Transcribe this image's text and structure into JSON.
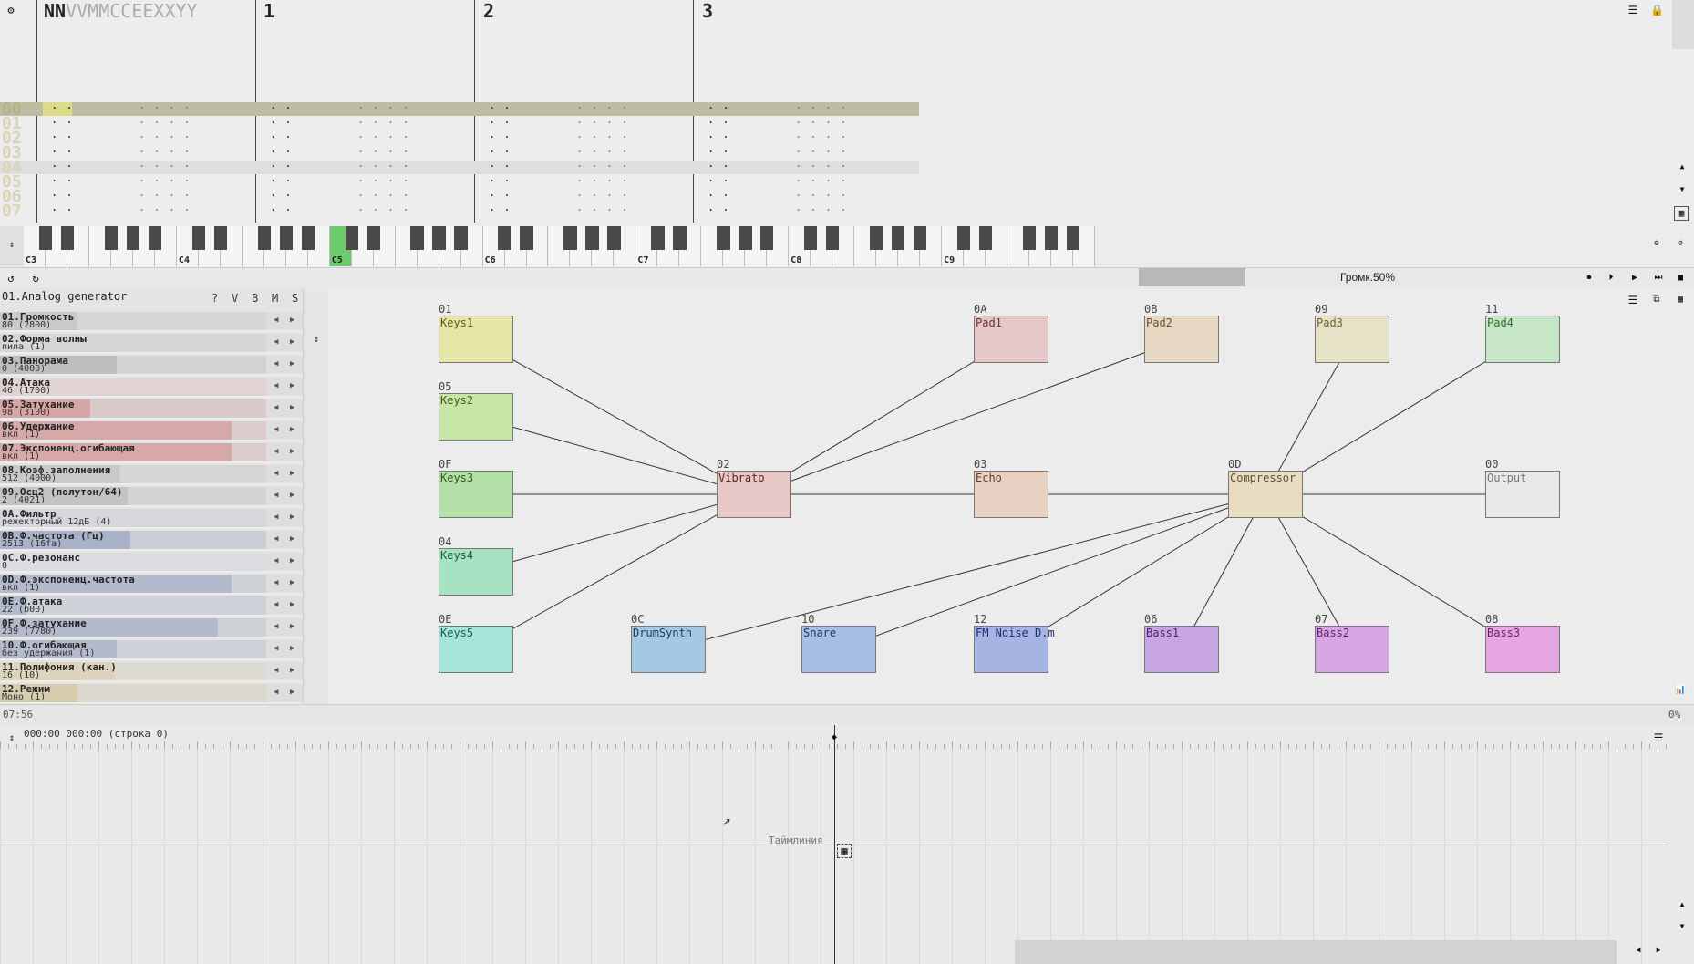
{
  "pattern": {
    "header_name": "NNVVMMCCEEXXYY",
    "header_name_bold": "NN",
    "header_name_rest": "VVMMCCEEXXYY",
    "channels": [
      "1",
      "2",
      "3"
    ],
    "rows": [
      "00",
      "01",
      "02",
      "03",
      "04",
      "05",
      "06",
      "07"
    ]
  },
  "piano": {
    "octaves": [
      "C3",
      "C4",
      "C5",
      "C6",
      "C7",
      "C8",
      "C9"
    ],
    "active_octave": "C5"
  },
  "toolbar": {
    "volume_label": "Громк.50%"
  },
  "instrument": {
    "title": "01.Analog generator",
    "flags": [
      "?",
      "V",
      "B",
      "M",
      "S"
    ]
  },
  "params": [
    {
      "name": "01.Громкость",
      "value": "80 (2800)",
      "fill": 0.29,
      "color": "#c9c9c9"
    },
    {
      "name": "02.Форма волны",
      "value": "пила (1)",
      "fill": 0.0,
      "color": "#c9c9c9"
    },
    {
      "name": "03.Панорама",
      "value": "0 (4000)",
      "fill": 0.44,
      "color": "#bdbdbd"
    },
    {
      "name": "04.Атака",
      "value": "46 (1700)",
      "fill": 0.0,
      "color": "#e7c0c0"
    },
    {
      "name": "05.Затухание",
      "value": "98 (3100)",
      "fill": 0.34,
      "color": "#d8a6a6"
    },
    {
      "name": "06.Удержание",
      "value": "вкл (1)",
      "fill": 0.87,
      "color": "#d6a8a8"
    },
    {
      "name": "07.Экспоненц.огибающая",
      "value": "вкл (1)",
      "fill": 0.87,
      "color": "#d6a8a8"
    },
    {
      "name": "08.Коэф.заполнения",
      "value": "512 (4000)",
      "fill": 0.45,
      "color": "#c9c9c9"
    },
    {
      "name": "09.Осц2 (полутон/64)",
      "value": "2 (4021)",
      "fill": 0.48,
      "color": "#c4c4c4"
    },
    {
      "name": "0A.Фильтр",
      "value": "режекторный 12дБ (4)",
      "fill": 0.0,
      "color": "#c7ccd8"
    },
    {
      "name": "0B.Ф.частота (Гц)",
      "value": "2513 (16fa)",
      "fill": 0.49,
      "color": "#a9b2c8"
    },
    {
      "name": "0C.Ф.резонанс",
      "value": "0",
      "fill": 0.0,
      "color": "#d8dbe2"
    },
    {
      "name": "0D.Ф.экспоненц.частота",
      "value": "вкл (1)",
      "fill": 0.87,
      "color": "#b3bacb"
    },
    {
      "name": "0E.Ф.атака",
      "value": "22 (b00)",
      "fill": 0.1,
      "color": "#b3bacb"
    },
    {
      "name": "0F.Ф.затухание",
      "value": "239 (7780)",
      "fill": 0.82,
      "color": "#b3bacb"
    },
    {
      "name": "10.Ф.огибающая",
      "value": "без удержания (1)",
      "fill": 0.44,
      "color": "#b3bacb"
    },
    {
      "name": "11.Полифония (кан.)",
      "value": "16 (10)",
      "fill": 0.43,
      "color": "#dcd4bc"
    },
    {
      "name": "12.Режим",
      "value": "Моно (1)",
      "fill": 0.29,
      "color": "#d6ccae"
    }
  ],
  "graph": {
    "nodes": [
      {
        "id": "01",
        "label": "Keys1",
        "bg": "#e6e6a6",
        "fg": "#5a5a20"
      },
      {
        "id": "05",
        "label": "Keys2",
        "bg": "#c7e6a6",
        "fg": "#3f5a20"
      },
      {
        "id": "0F",
        "label": "Keys3",
        "bg": "#b2e0a6",
        "fg": "#2f5a20"
      },
      {
        "id": "04",
        "label": "Keys4",
        "bg": "#a6e3c3",
        "fg": "#205a3e"
      },
      {
        "id": "0E",
        "label": "Keys5",
        "bg": "#a6e3d8",
        "fg": "#205a50"
      },
      {
        "id": "0A",
        "label": "Pad1",
        "bg": "#e6c7c7",
        "fg": "#6a3030"
      },
      {
        "id": "0B",
        "label": "Pad2",
        "bg": "#e6d8c3",
        "fg": "#6a5030"
      },
      {
        "id": "09",
        "label": "Pad3",
        "bg": "#e6e2c7",
        "fg": "#6a6030"
      },
      {
        "id": "11",
        "label": "Pad4",
        "bg": "#c7e6c7",
        "fg": "#306a30"
      },
      {
        "id": "02",
        "label": "Vibrato",
        "bg": "#e8c7c7",
        "fg": "#602020"
      },
      {
        "id": "03",
        "label": "Echo",
        "bg": "#e8d0c3",
        "fg": "#604030"
      },
      {
        "id": "0D",
        "label": "Compressor",
        "bg": "#e8dcc3",
        "fg": "#605030"
      },
      {
        "id": "00",
        "label": "Output",
        "bg": "#e8e8e8",
        "fg": "#777777"
      },
      {
        "id": "0C",
        "label": "DrumSynth",
        "bg": "#a6c9e3",
        "fg": "#203a60"
      },
      {
        "id": "10",
        "label": "Snare",
        "bg": "#a6c0e3",
        "fg": "#203060"
      },
      {
        "id": "12",
        "label": "FM Noise D.m",
        "bg": "#a6b4e3",
        "fg": "#202a70"
      },
      {
        "id": "06",
        "label": "Bass1",
        "bg": "#c7a6e3",
        "fg": "#502070"
      },
      {
        "id": "07",
        "label": "Bass2",
        "bg": "#d6a6e3",
        "fg": "#602070"
      },
      {
        "id": "08",
        "label": "Bass3",
        "bg": "#e6a6e3",
        "fg": "#702060"
      }
    ]
  },
  "status": {
    "time": "07:56",
    "percent": "0%"
  },
  "timeline": {
    "position": "000:00 000:00 (строка 0)",
    "track_label": "Таймлиния"
  }
}
